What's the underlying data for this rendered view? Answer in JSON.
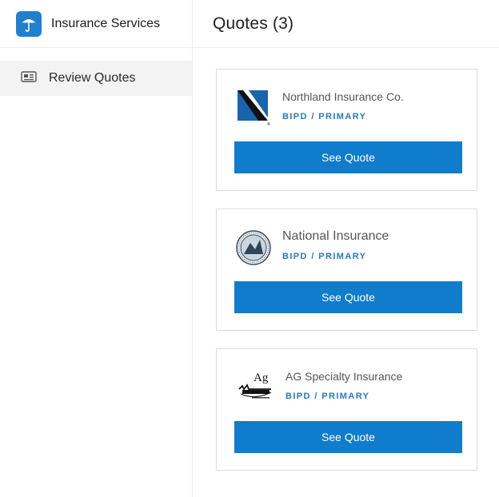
{
  "app": {
    "title": "Insurance Services",
    "logo_icon": "umbrella-icon",
    "accent": "#1f7fd0"
  },
  "sidebar": {
    "items": [
      {
        "label": "Review Quotes",
        "icon": "id-card-icon"
      }
    ]
  },
  "main": {
    "title": "Quotes (3)",
    "quotes": [
      {
        "company": "Northland Insurance Co.",
        "coverage": "BIPD / PRIMARY",
        "button": "See Quote",
        "logo": "northland-logo"
      },
      {
        "company": "National Insurance",
        "coverage": "BIPD / PRIMARY",
        "button": "See Quote",
        "logo": "national-seal-logo"
      },
      {
        "company": "AG Specialty Insurance",
        "coverage": "BIPD / PRIMARY",
        "button": "See Quote",
        "logo": "ag-specialty-logo"
      }
    ]
  },
  "colors": {
    "button": "#0f7ccc",
    "tag": "#2878c2",
    "active_nav_bg": "#f3f3f3"
  }
}
